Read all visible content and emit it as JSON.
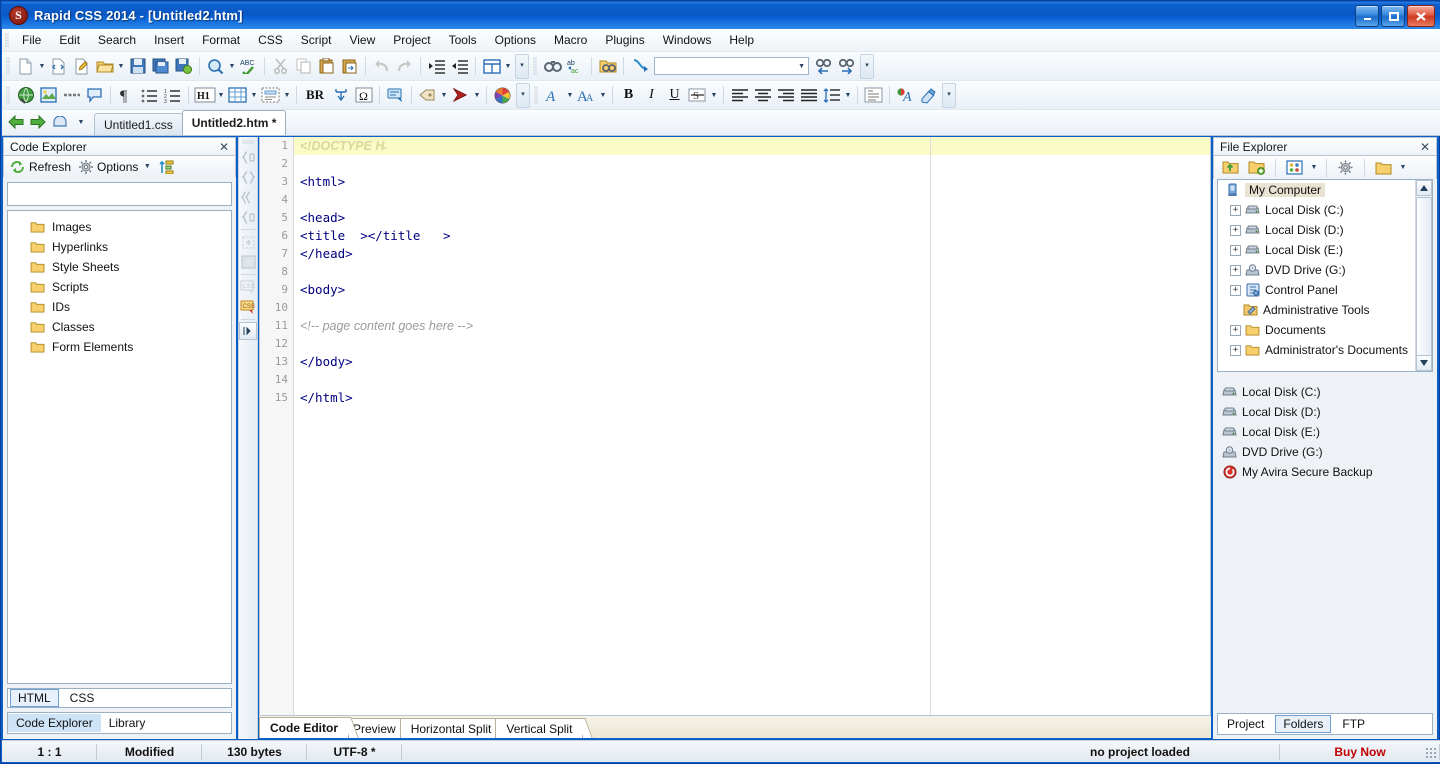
{
  "window": {
    "title": "Rapid CSS 2014 - [Untitled2.htm]",
    "logo_letter": "S",
    "buttons": {
      "minimize": "–",
      "maximize": "❐",
      "close": "✕"
    },
    "mdi_buttons": {
      "minimize": "_",
      "restore": "❐",
      "close": "✕"
    }
  },
  "menubar": {
    "items": [
      {
        "label": "File"
      },
      {
        "label": "Edit"
      },
      {
        "label": "Search"
      },
      {
        "label": "Insert"
      },
      {
        "label": "Format"
      },
      {
        "label": "CSS"
      },
      {
        "label": "Script"
      },
      {
        "label": "View"
      },
      {
        "label": "Project"
      },
      {
        "label": "Tools"
      },
      {
        "label": "Options"
      },
      {
        "label": "Macro"
      },
      {
        "label": "Plugins"
      },
      {
        "label": "Windows"
      },
      {
        "label": "Help"
      }
    ]
  },
  "toolbar1": {
    "search_value": "",
    "icons": [
      "new-document-icon",
      "new-document-dropdown",
      "new-from-template-icon",
      "edit-document-icon",
      "open-folder-icon",
      "open-dropdown",
      "save-icon",
      "save-all-icon",
      "save-as-web-icon",
      "preview-zoom-icon",
      "preview-dropdown",
      "spellcheck-icon",
      "cut-icon",
      "copy-icon",
      "paste-icon",
      "paste-special-icon",
      "undo-icon",
      "redo-icon",
      "indent-increase-icon",
      "indent-decrease-icon",
      "split-view-icon",
      "split-view-dropdown",
      "overflow-icon",
      "find-icon",
      "replace-icon",
      "find-in-files-icon",
      "goto-icon",
      "search-combobox",
      "find-previous-icon",
      "find-next-icon",
      "overflow-icon-2"
    ]
  },
  "toolbar2": {
    "br_label": "BR",
    "bold_label": "B",
    "italic_label": "I",
    "underline_label": "U",
    "h1_label": "H1",
    "omega_label": "Ω",
    "icons": [
      "insert-hyperlink-icon",
      "insert-image-icon",
      "horizontal-rule-icon",
      "insert-comment-icon",
      "paragraph-icon",
      "unordered-list-icon",
      "ordered-list-icon",
      "heading-icon",
      "heading-dropdown",
      "table-icon",
      "table-dropdown",
      "form-icon",
      "form-dropdown",
      "line-break-icon",
      "nbsp-icon",
      "special-character-icon",
      "css-style-icon",
      "tag-icon",
      "tag-dropdown",
      "bookmark-icon",
      "bookmark-dropdown",
      "color-picker-icon",
      "overflow-icon",
      "font-icon",
      "font-dropdown",
      "font-size-icon",
      "font-size-dropdown",
      "bold-icon",
      "italic-icon",
      "underline-icon",
      "strikethrough-icon",
      "strikethrough-dropdown",
      "align-left-icon",
      "align-center-icon",
      "align-right-icon",
      "align-justify-icon",
      "line-spacing-icon",
      "line-spacing-dropdown",
      "blockquote-icon",
      "text-color-icon",
      "highlight-color-icon",
      "overflow-icon-2"
    ]
  },
  "file_tabs": {
    "back_icon": "back-arrow-icon",
    "forward_icon": "forward-arrow-icon",
    "window_list_icon": "window-list-icon",
    "items": [
      {
        "label": "Untitled1.css",
        "active": false
      },
      {
        "label": "Untitled2.htm *",
        "active": true
      }
    ]
  },
  "code_explorer": {
    "title": "Code Explorer",
    "close_label": "✕",
    "toolbar": {
      "refresh_label": "Refresh",
      "options_label": "Options",
      "sort_icon": "sort-az-icon",
      "refresh_icon": "refresh-icon",
      "options_icon": "gear-icon"
    },
    "filter_value": "",
    "tree": [
      {
        "label": "Images",
        "icon": "folder-icon"
      },
      {
        "label": "Hyperlinks",
        "icon": "folder-icon"
      },
      {
        "label": "Style Sheets",
        "icon": "folder-icon"
      },
      {
        "label": "Scripts",
        "icon": "folder-icon"
      },
      {
        "label": "IDs",
        "icon": "folder-icon"
      },
      {
        "label": "Classes",
        "icon": "folder-icon"
      },
      {
        "label": "Form Elements",
        "icon": "folder-icon"
      }
    ],
    "lang_tabs": [
      {
        "label": "HTML",
        "selected": true
      },
      {
        "label": "CSS",
        "selected": false
      }
    ],
    "dock_tabs": [
      {
        "label": "Code Explorer",
        "selected": true
      },
      {
        "label": "Library",
        "selected": false
      }
    ]
  },
  "css_sidebar": {
    "icons": [
      "css-braces-1-icon",
      "css-braces-2-icon",
      "css-braces-3-icon",
      "css-braces-4-icon",
      "css-insert-icon",
      "css-box-icon",
      "css-tag-icon",
      "css-active-icon",
      "expand-panel-icon"
    ]
  },
  "editor": {
    "line_numbers": [
      "1",
      "2",
      "3",
      "4",
      "5",
      "6",
      "7",
      "8",
      "9",
      "10",
      "11",
      "12",
      "13",
      "14",
      "15"
    ],
    "lines": [
      {
        "n": 1,
        "text": "<!DOCTYPE H̵",
        "type": "doctype",
        "highlight": true
      },
      {
        "n": 2,
        "text": "",
        "type": "plain",
        "highlight": false
      },
      {
        "n": 3,
        "text": "<html>",
        "type": "tag",
        "highlight": false
      },
      {
        "n": 4,
        "text": "",
        "type": "plain",
        "highlight": false
      },
      {
        "n": 5,
        "text": "<head>",
        "type": "tag",
        "highlight": false
      },
      {
        "n": 6,
        "text": "<title  ></title   >",
        "type": "tag",
        "highlight": false
      },
      {
        "n": 7,
        "text": "</head>",
        "type": "tag",
        "highlight": false
      },
      {
        "n": 8,
        "text": "",
        "type": "plain",
        "highlight": false
      },
      {
        "n": 9,
        "text": "<body>",
        "type": "tag",
        "highlight": false
      },
      {
        "n": 10,
        "text": "",
        "type": "plain",
        "highlight": false
      },
      {
        "n": 11,
        "text": "<!-- page content goes here -->",
        "type": "comment",
        "highlight": false
      },
      {
        "n": 12,
        "text": "",
        "type": "plain",
        "highlight": false
      },
      {
        "n": 13,
        "text": "</body>",
        "type": "tag",
        "highlight": false
      },
      {
        "n": 14,
        "text": "",
        "type": "plain",
        "highlight": false
      },
      {
        "n": 15,
        "text": "</html>",
        "type": "tag",
        "highlight": false
      }
    ],
    "view_tabs": [
      {
        "label": "Code Editor",
        "selected": true
      },
      {
        "label": "Preview",
        "selected": false
      },
      {
        "label": "Horizontal Split",
        "selected": false
      },
      {
        "label": "Vertical Split",
        "selected": false
      }
    ]
  },
  "file_explorer": {
    "title": "File Explorer",
    "close_label": "✕",
    "toolbar_icons": [
      "up-folder-icon",
      "new-folder-icon",
      "view-mode-icon",
      "view-mode-dropdown",
      "settings-gear-icon",
      "folder-options-icon",
      "folder-options-dropdown"
    ],
    "tree": [
      {
        "label": "My Computer",
        "icon": "computer-icon",
        "expander": "",
        "selected": true,
        "indent": 0
      },
      {
        "label": "Local Disk (C:)",
        "icon": "drive-icon",
        "expander": "+",
        "selected": false,
        "indent": 1
      },
      {
        "label": "Local Disk (D:)",
        "icon": "drive-icon",
        "expander": "+",
        "selected": false,
        "indent": 1
      },
      {
        "label": "Local Disk (E:)",
        "icon": "drive-icon",
        "expander": "+",
        "selected": false,
        "indent": 1
      },
      {
        "label": "DVD Drive (G:)",
        "icon": "dvd-icon",
        "expander": "+",
        "selected": false,
        "indent": 1
      },
      {
        "label": "Control Panel",
        "icon": "control-panel-icon",
        "expander": "+",
        "selected": false,
        "indent": 1
      },
      {
        "label": "Administrative Tools",
        "icon": "admin-tools-icon",
        "expander": "",
        "selected": false,
        "indent": 1
      },
      {
        "label": "Documents",
        "icon": "folder-icon",
        "expander": "+",
        "selected": false,
        "indent": 1
      },
      {
        "label": "Administrator's Documents",
        "icon": "folder-icon",
        "expander": "+",
        "selected": false,
        "indent": 1
      }
    ],
    "scroll": {
      "up": "▲",
      "down": "▼"
    },
    "list": [
      {
        "label": "Local Disk (C:)",
        "icon": "drive-icon"
      },
      {
        "label": "Local Disk (D:)",
        "icon": "drive-icon"
      },
      {
        "label": "Local Disk (E:)",
        "icon": "drive-icon"
      },
      {
        "label": "DVD Drive (G:)",
        "icon": "dvd-icon"
      },
      {
        "label": "My Avira Secure Backup",
        "icon": "avira-icon"
      }
    ],
    "bottom_tabs": [
      {
        "label": "Project",
        "selected": false
      },
      {
        "label": "Folders",
        "selected": true
      },
      {
        "label": "FTP",
        "selected": false
      }
    ]
  },
  "statusbar": {
    "cursor": "1 : 1",
    "modified": "Modified",
    "size": "130 bytes",
    "encoding": "UTF-8 *",
    "project": "no project loaded",
    "buy_now": "Buy Now"
  },
  "colors": {
    "titlebar": "#0a57c4",
    "accent": "#3d8ee0",
    "buy_now": "#c00000",
    "tag": "#000080",
    "comment": "#9b9b9b",
    "highlight_line": "#fbfbc8"
  }
}
